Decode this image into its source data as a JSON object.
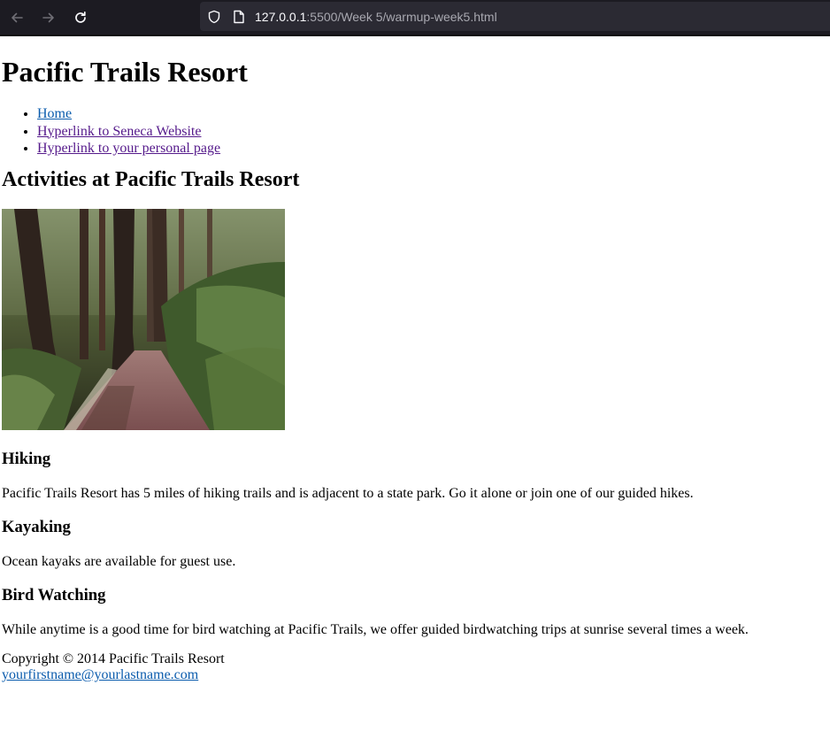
{
  "browser": {
    "url_host": "127.0.0.1",
    "url_path": ":5500/Week 5/warmup-week5.html"
  },
  "page": {
    "title": "Pacific Trails Resort",
    "nav": [
      {
        "label": "Home"
      },
      {
        "label": "Hyperlink to Seneca Website"
      },
      {
        "label": "Hyperlink to your personal page"
      }
    ],
    "section_title": "Activities at Pacific Trails Resort",
    "activities": [
      {
        "heading": "Hiking",
        "text": "Pacific Trails Resort has 5 miles of hiking trails and is adjacent to a state park. Go it alone or join one of our guided hikes."
      },
      {
        "heading": "Kayaking",
        "text": "Ocean kayaks are available for guest use."
      },
      {
        "heading": "Bird Watching",
        "text": "While anytime is a good time for bird watching at Pacific Trails, we offer guided birdwatching trips at sunrise several times a week."
      }
    ],
    "footer": {
      "copyright": "Copyright © 2014 Pacific Trails Resort",
      "email": "yourfirstname@yourlastname.com"
    }
  },
  "colors": {
    "link": "#0b5cad",
    "visited_link": "#551a8b",
    "browser_bg": "#1c1b22"
  }
}
